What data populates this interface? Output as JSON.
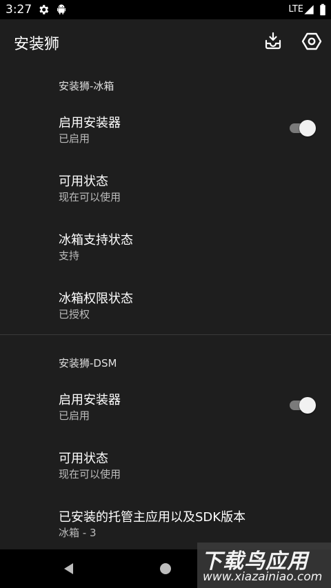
{
  "status_bar": {
    "time": "3:27",
    "network": "LTE",
    "icons": [
      "gear-icon",
      "android-icon",
      "signal-icon",
      "battery-icon"
    ]
  },
  "app_bar": {
    "title": "安装狮",
    "actions": [
      "install-icon",
      "settings-hex-icon"
    ]
  },
  "sections": [
    {
      "header": "安装狮-冰箱",
      "prefs": [
        {
          "title": "启用安装器",
          "summary": "已启用",
          "switch_on": true
        },
        {
          "title": "可用状态",
          "summary": "现在可以使用"
        },
        {
          "title": "冰箱支持状态",
          "summary": "支持"
        },
        {
          "title": "冰箱权限状态",
          "summary": "已授权"
        }
      ]
    },
    {
      "header": "安装狮-DSM",
      "prefs": [
        {
          "title": "启用安装器",
          "summary": "已启用",
          "switch_on": true
        },
        {
          "title": "可用状态",
          "summary": "现在可以使用"
        },
        {
          "title": "已安装的托管主应用以及SDK版本",
          "summary": "冰箱 - 3"
        }
      ]
    }
  ],
  "watermark": {
    "text": "下载鸟应用",
    "url": "www.xiazainiao.com"
  },
  "colors": {
    "background": "#1e1e1e",
    "switch_thumb": "#f1f1f1",
    "switch_track": "#7a7a7a"
  }
}
